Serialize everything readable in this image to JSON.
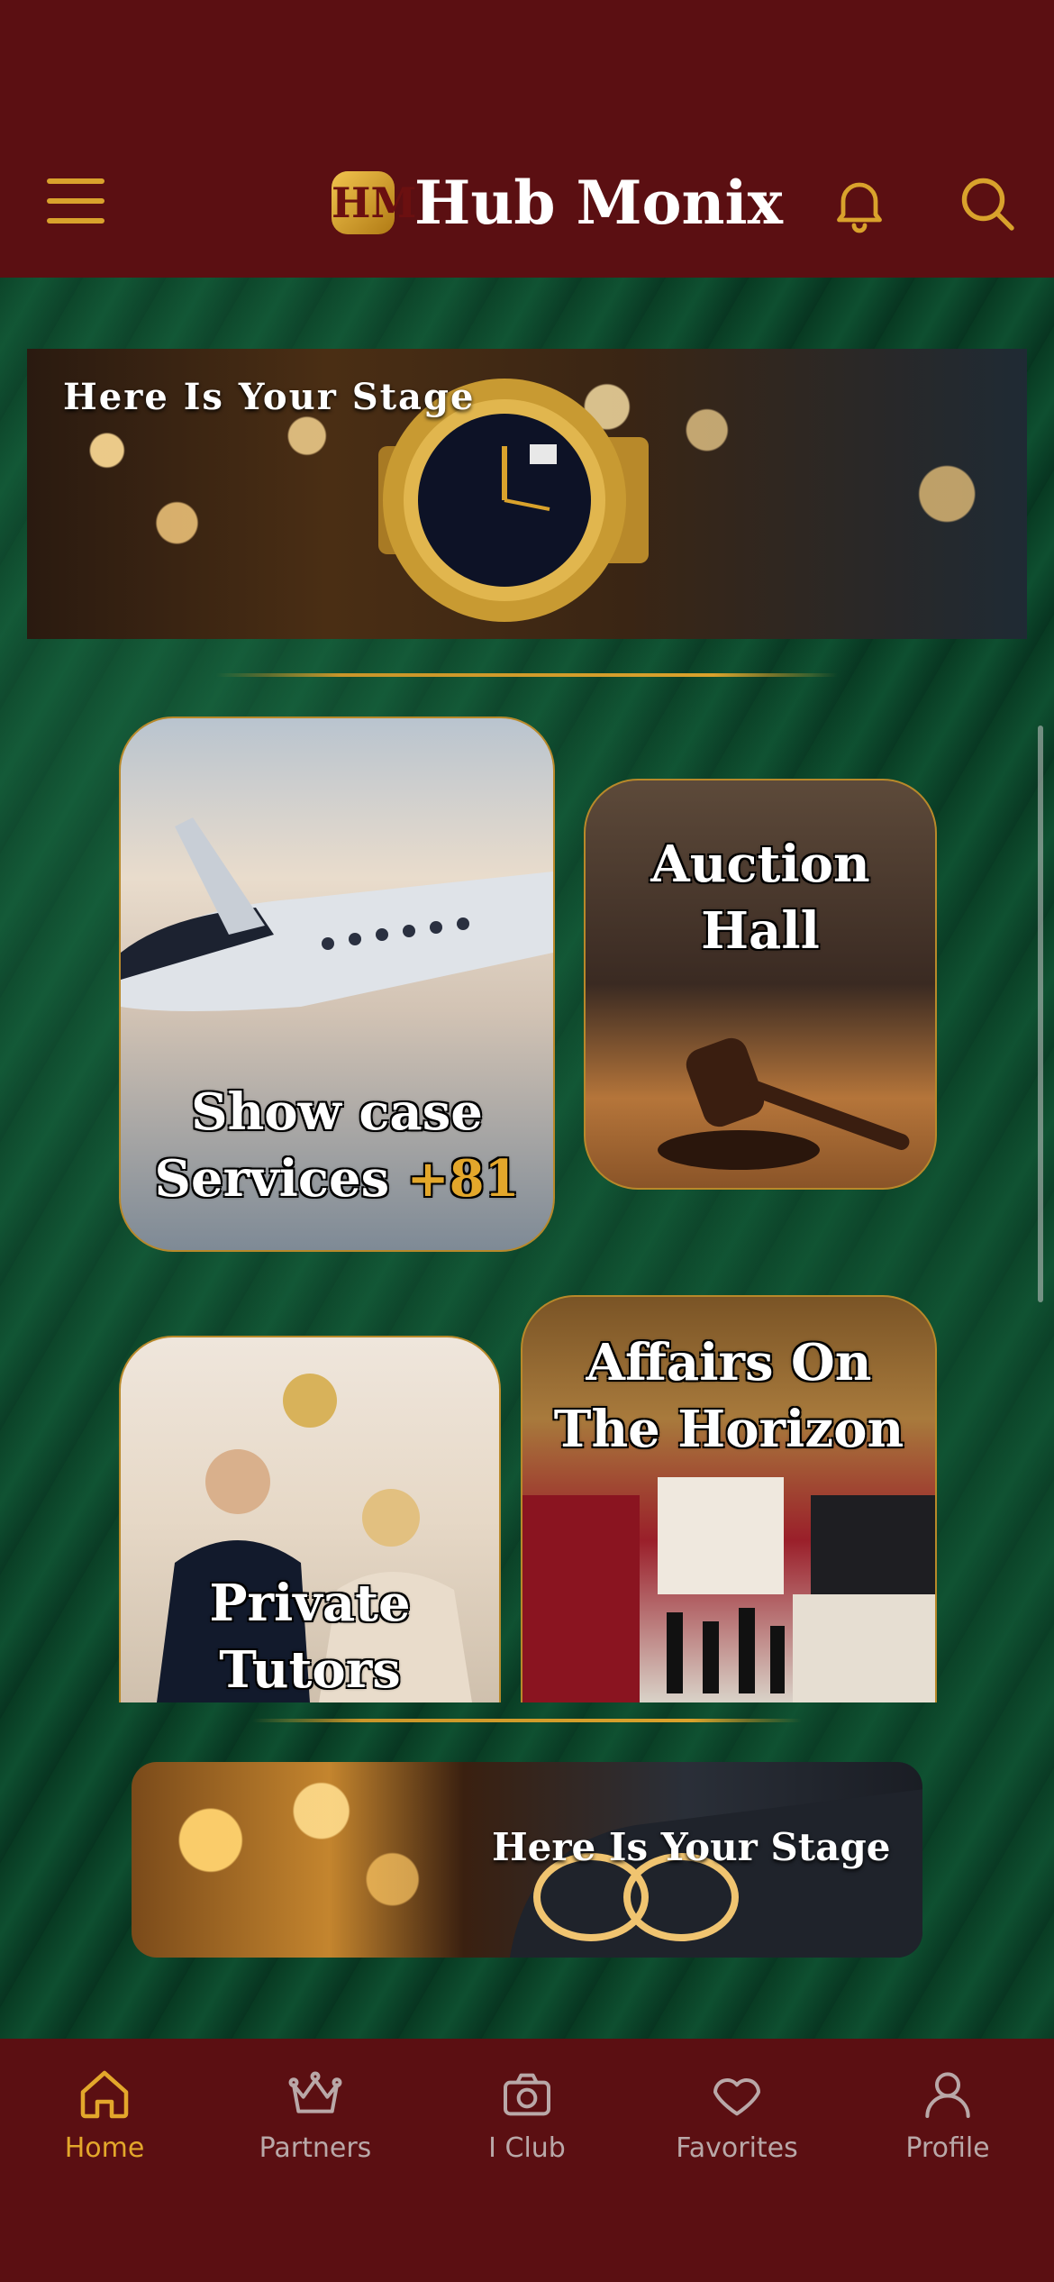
{
  "header": {
    "app_name": "Hub Monix",
    "logo_letters": "HM"
  },
  "banners": {
    "top": {
      "title": "Here Is Your Stage"
    },
    "bottom": {
      "title": "Here Is Your Stage"
    }
  },
  "tiles": [
    {
      "line1": "Show case",
      "line2": "Services",
      "badge": "+81"
    },
    {
      "line1": "Auction",
      "line2": "Hall"
    },
    {
      "line1": "Private",
      "line2": "Tutors"
    },
    {
      "line1": "Affairs On",
      "line2": "The Horizon"
    }
  ],
  "nav": {
    "items": [
      {
        "label": "Home",
        "icon": "home-icon",
        "active": true
      },
      {
        "label": "Partners",
        "icon": "crown-icon"
      },
      {
        "label": "I Club",
        "icon": "camera-icon"
      },
      {
        "label": "Favorites",
        "icon": "heart-icon"
      },
      {
        "label": "Profile",
        "icon": "user-icon"
      }
    ]
  },
  "colors": {
    "header_bg": "#5b0f12",
    "accent_gold": "#d9a22c",
    "main_green": "#0a4428",
    "inactive_nav": "#b9a8a8"
  }
}
